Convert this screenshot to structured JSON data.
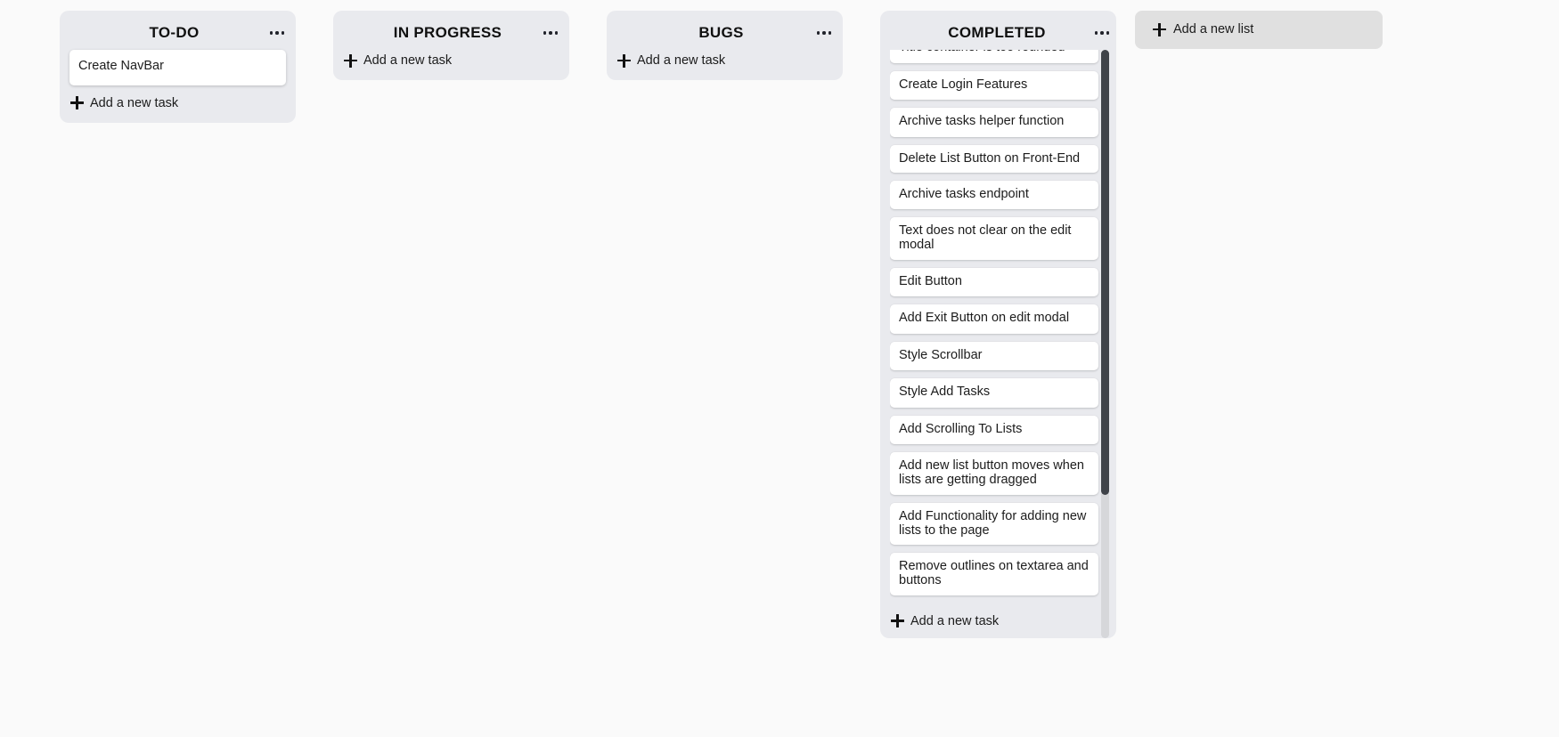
{
  "board": {
    "add_list_label": "Add a new list",
    "add_task_label": "Add a new task",
    "menu_icon": "ellipsis-horizontal-icon",
    "plus_icon": "plus-icon",
    "colors": {
      "page_background": "#fafafa",
      "list_background": "#e9eaee",
      "card_background": "#ffffff",
      "add_list_background": "#e0e0e0",
      "scrollbar_thumb": "#3f4349",
      "scrollbar_track": "#d6d7da",
      "text": "#1b1b1b"
    },
    "lists": [
      {
        "title": "TO-DO",
        "add_task_label": "Add a new task",
        "scrollable": false,
        "tasks": [
          {
            "text": "Create NavBar",
            "active": true
          }
        ]
      },
      {
        "title": "IN PROGRESS",
        "add_task_label": "Add a new task",
        "scrollable": false,
        "tasks": []
      },
      {
        "title": "BUGS",
        "add_task_label": "Add a new task",
        "scrollable": false,
        "tasks": []
      },
      {
        "title": "COMPLETED",
        "add_task_label": "Add a new task",
        "scrollable": true,
        "scroll_position": "middle",
        "tasks": [
          {
            "text": "Title container is too rounded"
          },
          {
            "text": "Create Login Features"
          },
          {
            "text": "Archive tasks helper function"
          },
          {
            "text": "Delete List Button on Front-End"
          },
          {
            "text": "Archive tasks endpoint"
          },
          {
            "text": "Text does not clear on the edit modal"
          },
          {
            "text": "Edit Button"
          },
          {
            "text": "Add Exit Button on edit modal"
          },
          {
            "text": "Style Scrollbar"
          },
          {
            "text": "Style Add Tasks"
          },
          {
            "text": "Add Scrolling To Lists"
          },
          {
            "text": "Add new list button moves when lists are getting dragged"
          },
          {
            "text": "Add Functionality for adding new lists to the page"
          },
          {
            "text": "Remove outlines on textarea and buttons"
          }
        ]
      }
    ]
  }
}
